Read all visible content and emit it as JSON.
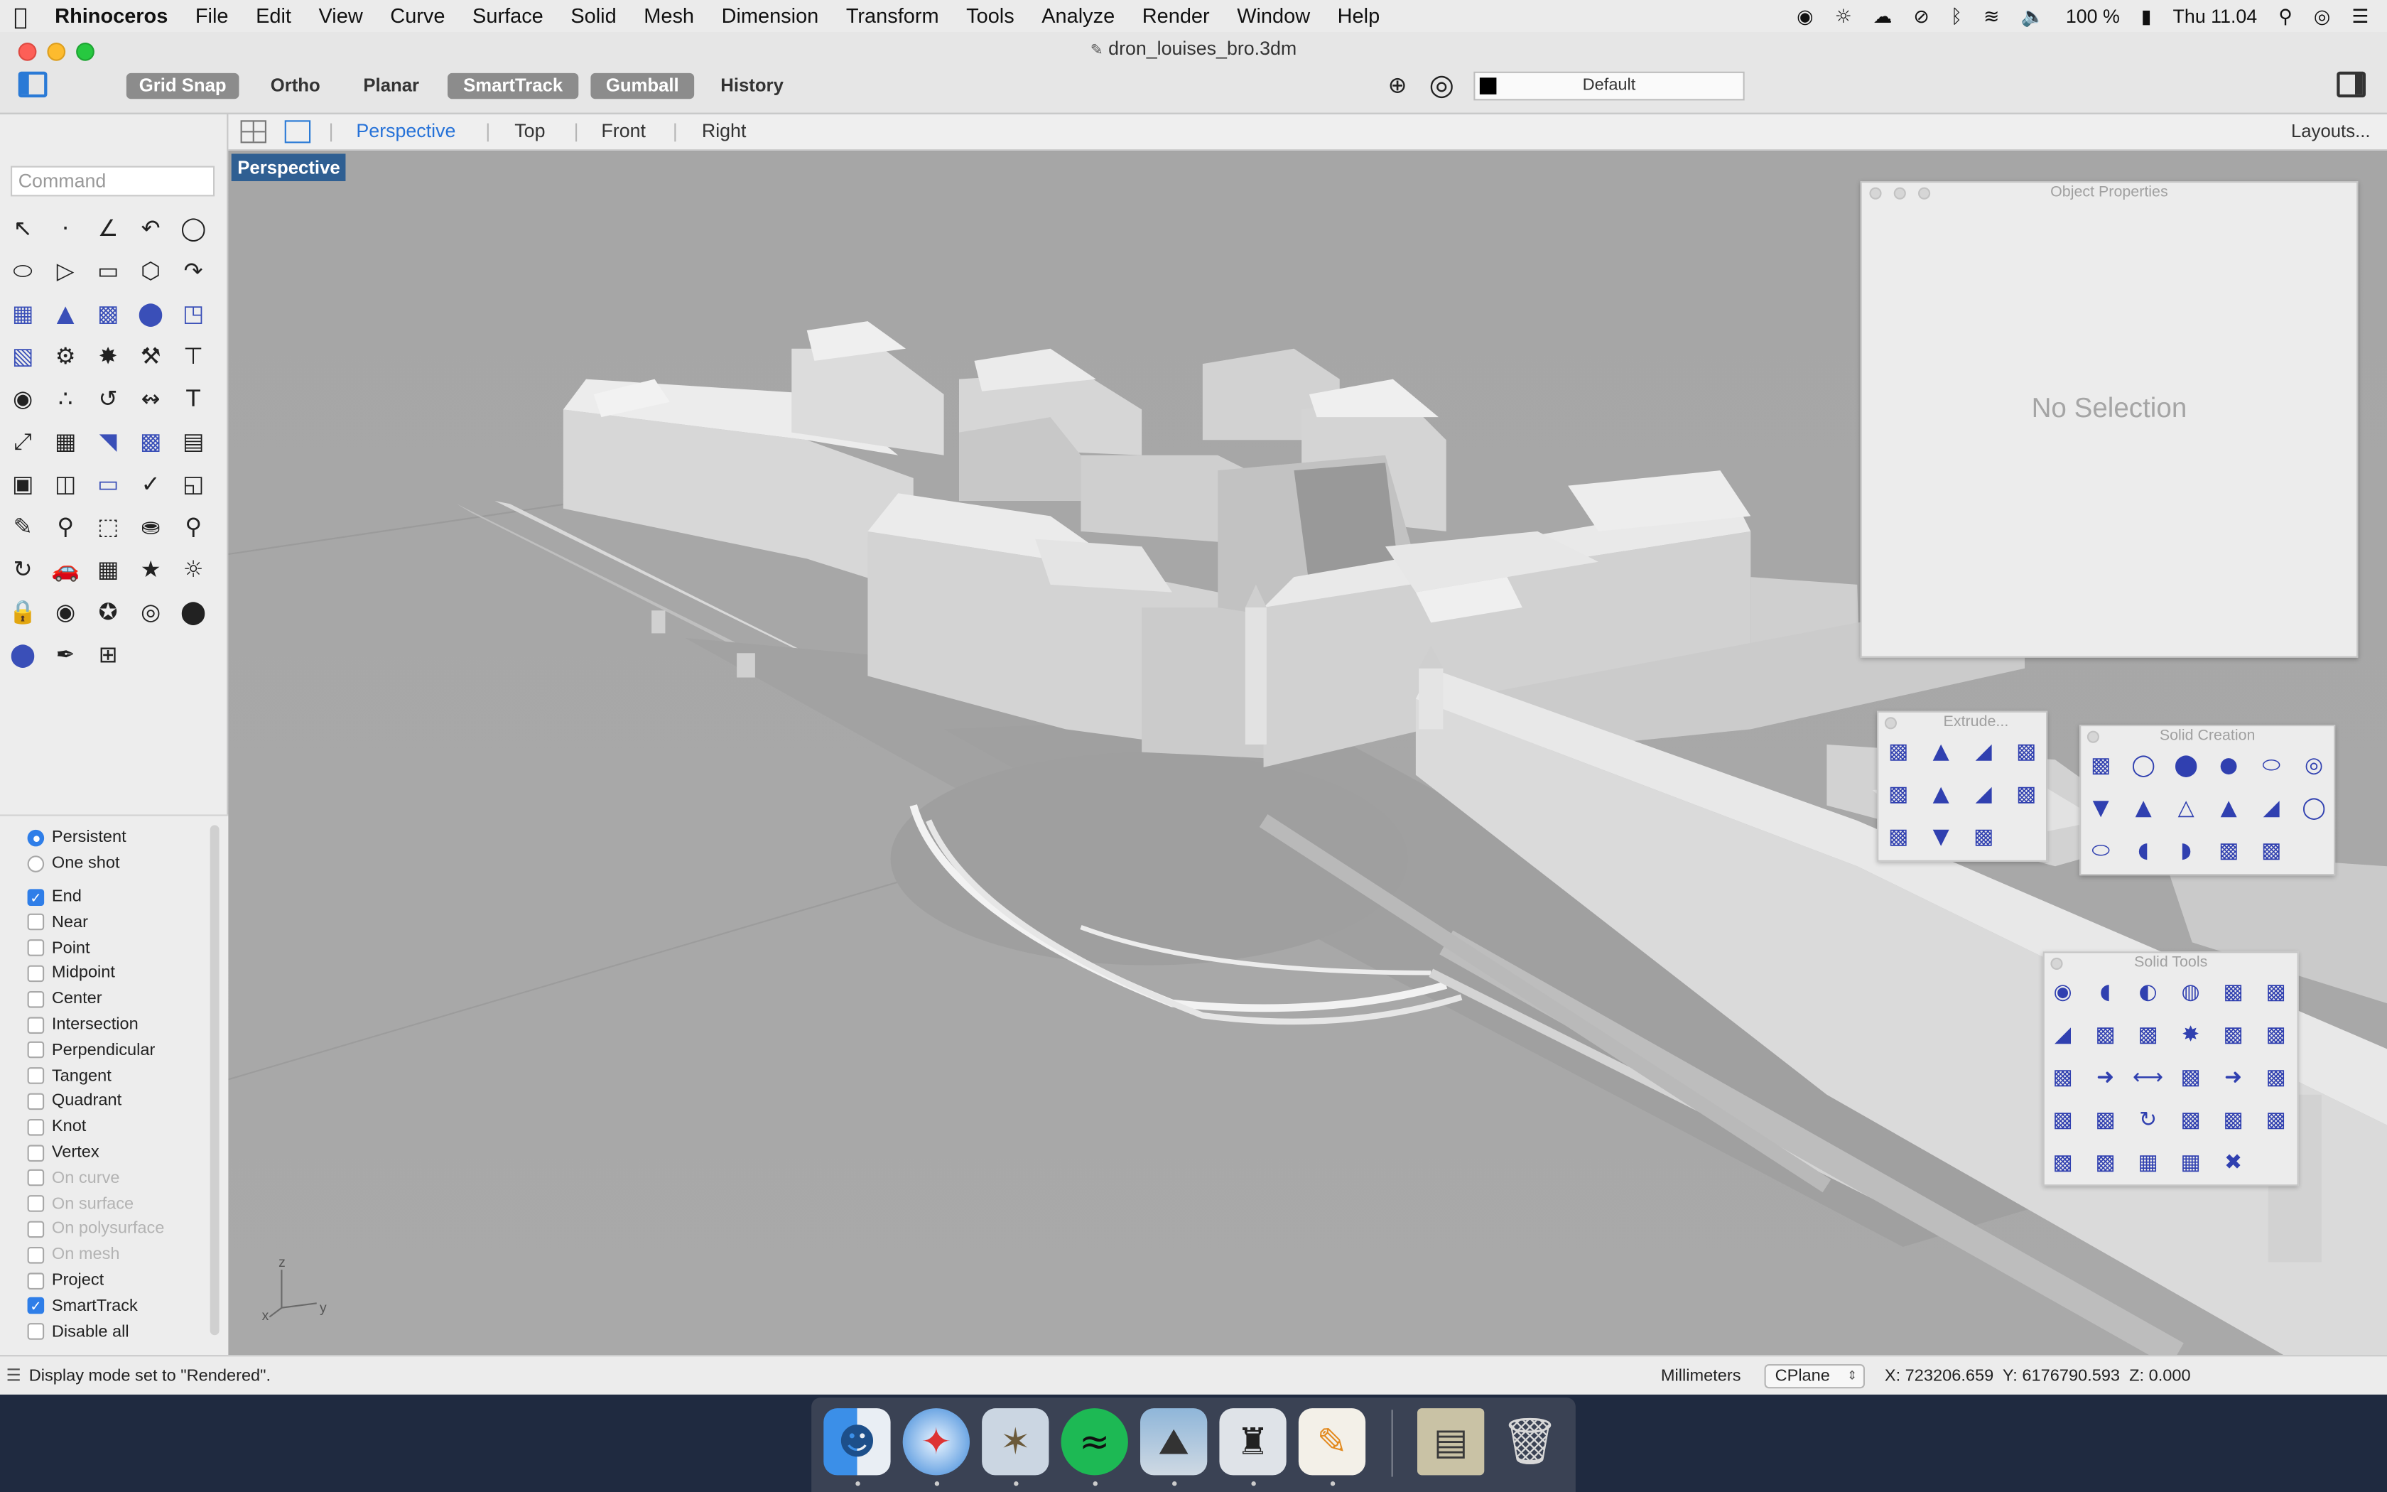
{
  "menubar": {
    "app_name": "Rhinoceros",
    "items": [
      "File",
      "Edit",
      "View",
      "Curve",
      "Surface",
      "Solid",
      "Mesh",
      "Dimension",
      "Transform",
      "Tools",
      "Analyze",
      "Render",
      "Window",
      "Help"
    ],
    "battery": "100 %",
    "clock": "Thu 11.04"
  },
  "window": {
    "title": "dron_louises_bro.3dm",
    "toolbar": [
      "Grid Snap",
      "Ortho",
      "Planar",
      "SmartTrack",
      "Gumball",
      "History"
    ],
    "toolbar_active": [
      "Grid Snap",
      "SmartTrack",
      "Gumball"
    ],
    "layer": "Default"
  },
  "command": {
    "placeholder": "Command"
  },
  "viewport_tabs": {
    "tabs": [
      "Perspective",
      "Top",
      "Front",
      "Right"
    ],
    "active": "Perspective",
    "layouts": "Layouts..."
  },
  "viewport": {
    "label": "Perspective",
    "axis_z": "z",
    "axis_y": "y",
    "axis_x": "x"
  },
  "osnap": {
    "modes": [
      {
        "label": "Persistent",
        "selected": true
      },
      {
        "label": "One shot",
        "selected": false
      }
    ],
    "items": [
      {
        "label": "End",
        "checked": true,
        "enabled": true
      },
      {
        "label": "Near",
        "checked": false,
        "enabled": true
      },
      {
        "label": "Point",
        "checked": false,
        "enabled": true
      },
      {
        "label": "Midpoint",
        "checked": false,
        "enabled": true
      },
      {
        "label": "Center",
        "checked": false,
        "enabled": true
      },
      {
        "label": "Intersection",
        "checked": false,
        "enabled": true
      },
      {
        "label": "Perpendicular",
        "checked": false,
        "enabled": true
      },
      {
        "label": "Tangent",
        "checked": false,
        "enabled": true
      },
      {
        "label": "Quadrant",
        "checked": false,
        "enabled": true
      },
      {
        "label": "Knot",
        "checked": false,
        "enabled": true
      },
      {
        "label": "Vertex",
        "checked": false,
        "enabled": true
      },
      {
        "label": "On curve",
        "checked": false,
        "enabled": false
      },
      {
        "label": "On surface",
        "checked": false,
        "enabled": false
      },
      {
        "label": "On polysurface",
        "checked": false,
        "enabled": false
      },
      {
        "label": "On mesh",
        "checked": false,
        "enabled": false
      },
      {
        "label": "Project",
        "checked": false,
        "enabled": true
      },
      {
        "label": "SmartTrack",
        "checked": true,
        "enabled": true
      },
      {
        "label": "Disable all",
        "checked": false,
        "enabled": true
      }
    ]
  },
  "panels": {
    "object_properties": {
      "title": "Object Properties",
      "body": "No Selection"
    },
    "extrude": {
      "title": "Extrude..."
    },
    "solid_creation": {
      "title": "Solid Creation"
    },
    "solid_tools": {
      "title": "Solid Tools"
    }
  },
  "status": {
    "message": "Display mode set to \"Rendered\".",
    "units": "Millimeters",
    "cplane": "CPlane",
    "coords": "X: 723206.659  Y: 6176790.593  Z: 0.000"
  },
  "dock": {
    "apps": [
      "finder-icon",
      "safari-icon",
      "preview-icon",
      "spotify-icon",
      "photos-icon",
      "rhinoceros-icon",
      "pages-icon",
      "document-icon",
      "trash-icon"
    ]
  },
  "colors": {
    "accent": "#2f7ee8",
    "viewport_bg": "#a7a7a7",
    "viewport_label": "#2f5f92",
    "solid_icon": "#3040b0"
  }
}
